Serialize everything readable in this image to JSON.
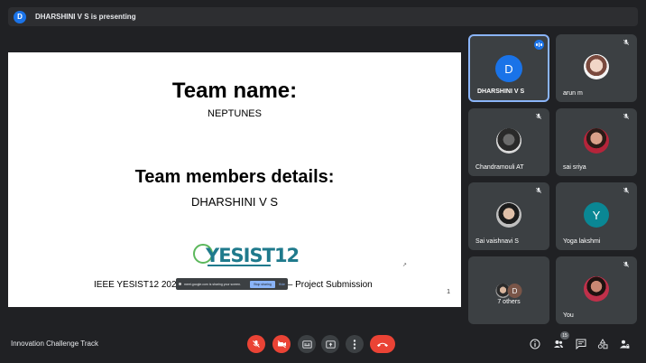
{
  "presenting_bar": {
    "avatar_letter": "D",
    "text": "DHARSHINI V S is presenting"
  },
  "slide": {
    "title1": "Team name:",
    "subtitle1": "NEPTUNES",
    "title2": "Team members details:",
    "subtitle2": "DHARSHINI V S",
    "logo_text": "YESIST12",
    "footer_left": "IEEE YESIST12 202",
    "footer_right": "k – Project Submission",
    "page_number": "1",
    "share_toast": {
      "text": "meet.google.com is sharing your screen.",
      "stop_label": "Stop sharing",
      "hide_label": "Hide"
    }
  },
  "participants": [
    {
      "name": "DHARSHINI V S",
      "avatar": "D",
      "speaking": true
    },
    {
      "name": "arun m"
    },
    {
      "name": "Chandramouli AT"
    },
    {
      "name": "sai sriya"
    },
    {
      "name": "Sai vaishnavi S"
    },
    {
      "name": "Yoga lakshmi",
      "avatar": "Y"
    },
    {
      "name": "7 others",
      "avatar": "D"
    },
    {
      "name": "You"
    }
  ],
  "bottom_bar": {
    "meeting_name": "Innovation Challenge Track",
    "participant_count": "15"
  },
  "colors": {
    "background": "#202124",
    "tile": "#3c4043",
    "accent": "#1a73e8",
    "danger": "#ea4335"
  }
}
